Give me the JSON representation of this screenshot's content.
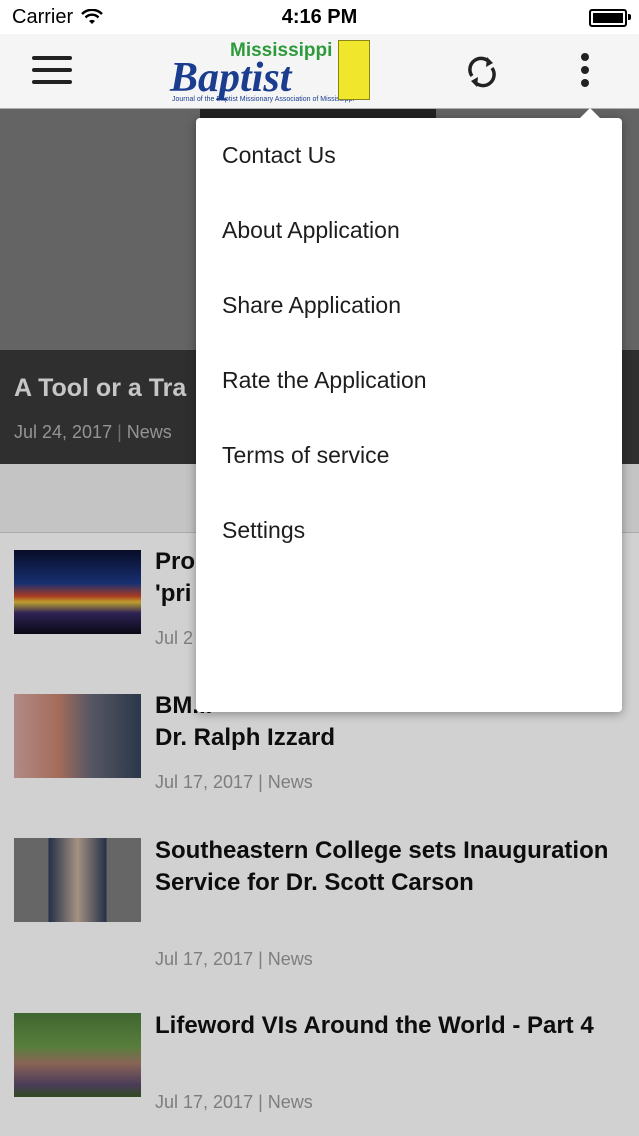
{
  "status": {
    "carrier": "Carrier",
    "time": "4:16 PM"
  },
  "appbar": {
    "logo_top": "Mississippi",
    "logo_main": "Baptist",
    "logo_tagline": "Journal of the Baptist Missionary Association of Mississippi"
  },
  "hero": {
    "title": "A Tool or a Tra",
    "date": "Jul 24, 2017",
    "category": "News"
  },
  "articles": [
    {
      "headline": "Pro\n'pri",
      "date": "Jul 2",
      "category": ""
    },
    {
      "headline": "BM...\nDr. Ralph Izzard",
      "date": "Jul 17, 2017",
      "category": "News"
    },
    {
      "headline": "Southeastern College sets Inauguration Service for Dr. Scott Carson",
      "date": "Jul 17, 2017",
      "category": "News"
    },
    {
      "headline": "Lifeword VIs Around the World - Part 4",
      "date": "Jul 17, 2017",
      "category": "News"
    }
  ],
  "menu": {
    "items": [
      "Contact Us",
      "About Application",
      "Share Application",
      "Rate the Application",
      "Terms of service",
      "Settings"
    ]
  },
  "meta_separator": "|"
}
